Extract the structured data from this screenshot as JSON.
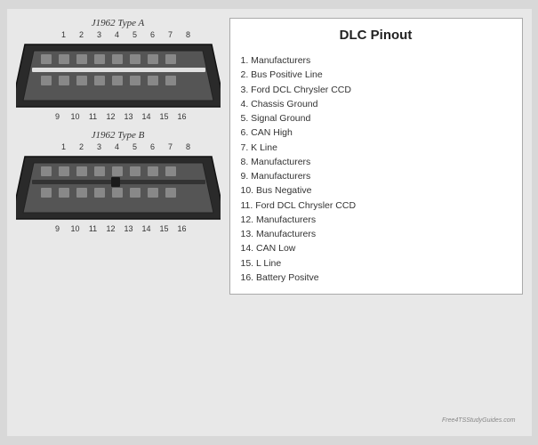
{
  "title": "DLC Pinout",
  "connector_a": {
    "label": "J1962 Type A",
    "top_pins": [
      "1",
      "2",
      "3",
      "4",
      "5",
      "6",
      "7",
      "8"
    ],
    "bottom_pins": [
      "9",
      "10",
      "11",
      "12",
      "13",
      "14",
      "15",
      "16"
    ]
  },
  "connector_b": {
    "label": "J1962 Type B",
    "top_pins": [
      "1",
      "2",
      "3",
      "4",
      "5",
      "6",
      "7",
      "8"
    ],
    "bottom_pins": [
      "9",
      "10",
      "11",
      "12",
      "13",
      "14",
      "15",
      "16"
    ]
  },
  "pinout": [
    "1. Manufacturers",
    "2. Bus Positive Line",
    "3. Ford DCL Chrysler CCD",
    "4. Chassis Ground",
    "5. Signal Ground",
    "6. CAN High",
    "7. K Line",
    "8. Manufacturers",
    "9. Manufacturers",
    "10. Bus Negative",
    "11. Ford DCL Chrysler CCD",
    "12. Manufacturers",
    "13. Manufacturers",
    "14. CAN Low",
    "15. L Line",
    "16. Battery Positve"
  ],
  "watermark": "Free4TSStudyGuides.com"
}
